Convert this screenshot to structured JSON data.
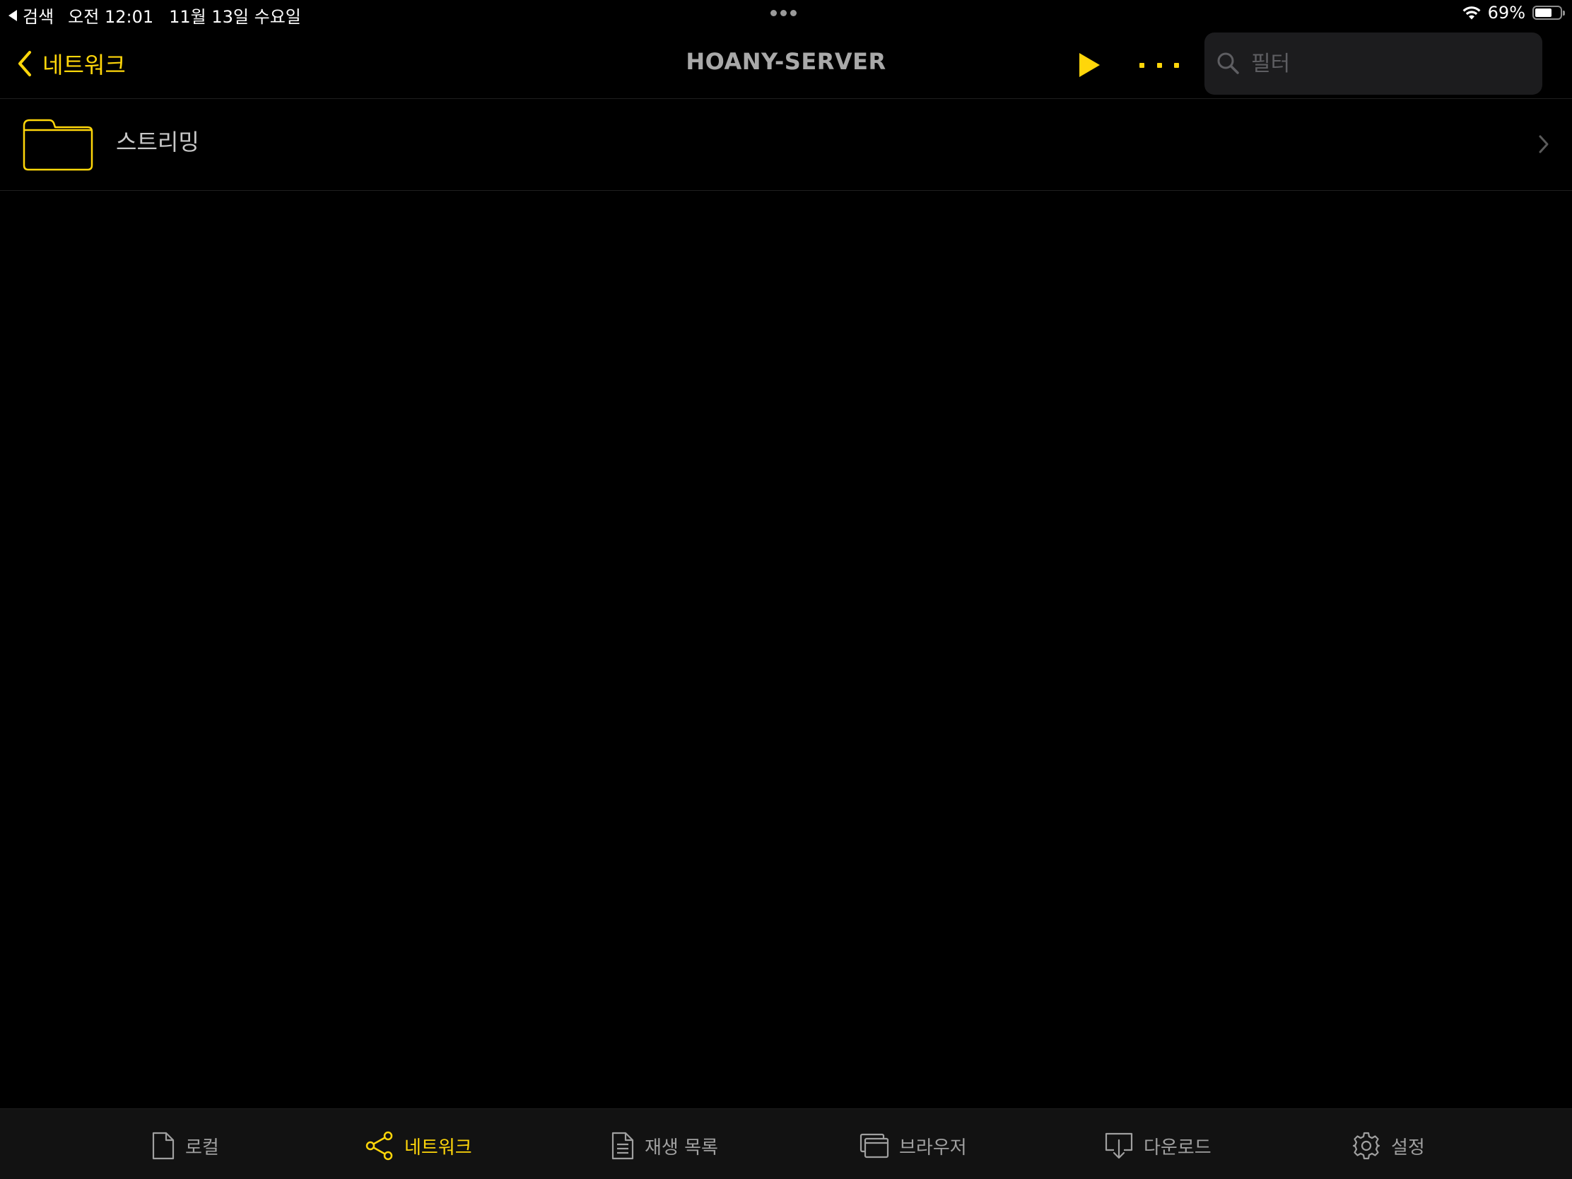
{
  "status_bar": {
    "back_app": "검색",
    "time": "오전 12:01",
    "date": "11월 13일 수요일",
    "battery_percent": "69%",
    "battery_level": 0.69
  },
  "nav": {
    "back_label": "네트워크",
    "title": "HOANY-SERVER",
    "search_placeholder": "필터"
  },
  "list": {
    "items": [
      {
        "label": "스트리밍",
        "icon": "folder-icon"
      }
    ]
  },
  "tabs": [
    {
      "label": "로컬",
      "icon": "document-icon",
      "active": false
    },
    {
      "label": "네트워크",
      "icon": "share-network-icon",
      "active": true
    },
    {
      "label": "재생 목록",
      "icon": "playlist-icon",
      "active": false
    },
    {
      "label": "브라우저",
      "icon": "browser-window-icon",
      "active": false
    },
    {
      "label": "다운로드",
      "icon": "download-icon",
      "active": false
    },
    {
      "label": "설정",
      "icon": "gear-icon",
      "active": false
    }
  ],
  "colors": {
    "accent": "#ffd60a",
    "background": "#000000",
    "tab_bar": "#121212",
    "search_field": "#1c1c1e",
    "inactive": "#a0a0a0"
  }
}
